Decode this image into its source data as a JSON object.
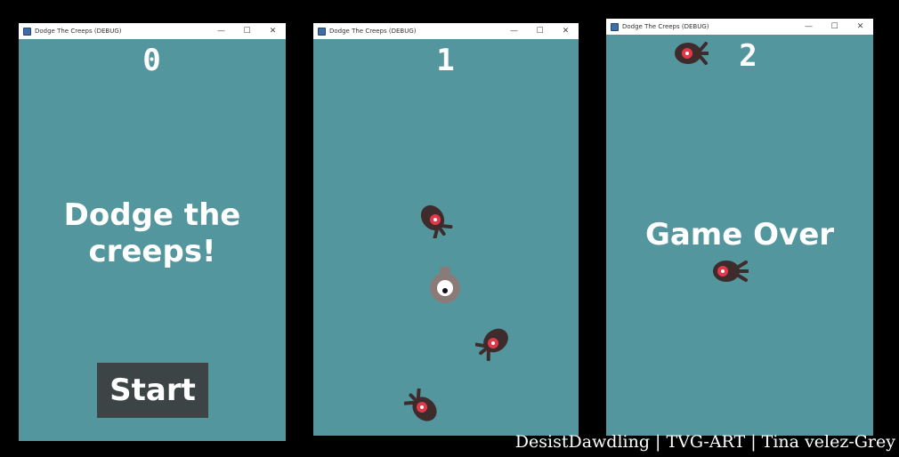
{
  "windows": [
    {
      "title": "Dodge The Creeps (DEBUG)",
      "controls": {
        "minimize": "—",
        "maximize": "☐",
        "close": "✕"
      },
      "score": "0",
      "message": "Dodge the creeps!",
      "start_button": "Start"
    },
    {
      "title": "Dodge The Creeps (DEBUG)",
      "controls": {
        "minimize": "—",
        "maximize": "☐",
        "close": "✕"
      },
      "score": "1"
    },
    {
      "title": "Dodge The Creeps (DEBUG)",
      "controls": {
        "minimize": "—",
        "maximize": "☐",
        "close": "✕"
      },
      "score": "2",
      "message": "Game Over"
    }
  ],
  "colors": {
    "background": "#53969d",
    "creep_body": "#3e2b2b",
    "creep_eye": "#e2394a",
    "player_body": "#8b7b78",
    "button": "#3c4446",
    "text": "#ffffff"
  },
  "sprites": {
    "creep": "creep-mob-icon",
    "player": "player-character-icon"
  },
  "credit": "DesistDawdling | TVG-ART | Tina velez-Grey"
}
